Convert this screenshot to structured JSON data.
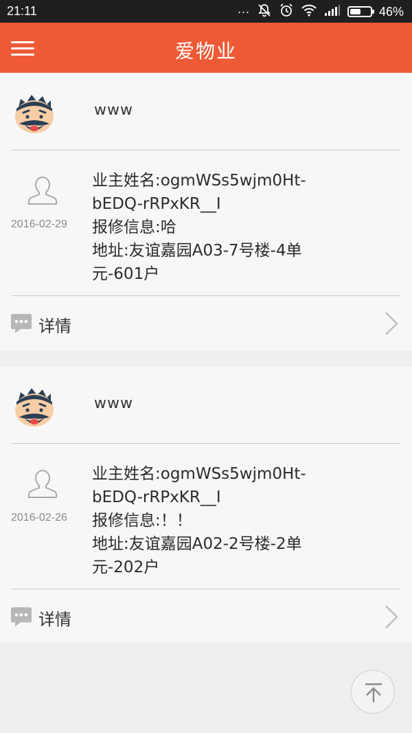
{
  "status_bar": {
    "time": "21:11",
    "signal_dots": "...",
    "battery_percent": "46%"
  },
  "header": {
    "title": "爱物业",
    "menu_icon": "hamburger-menu-icon"
  },
  "colors": {
    "header_bg": "#ee5a36",
    "status_bar_bg": "#1f1f1f",
    "card_bg": "#f7f7f7",
    "page_bg": "#efefef"
  },
  "posts": [
    {
      "poster_name": "www",
      "date": "2016-02-29",
      "info_lines": [
        "业主姓名:ogmWSs5wjm0Ht-",
        "bEDQ-rRPxKR__I",
        "报修信息:哈",
        "地址:友谊嘉园A03-7号楼-4单",
        "元-601户"
      ],
      "details_label": "详情"
    },
    {
      "poster_name": "www",
      "date": "2016-02-26",
      "info_lines": [
        "业主姓名:ogmWSs5wjm0Ht-",
        "bEDQ-rRPxKR__I",
        "报修信息:！！",
        "地址:友谊嘉园A02-2号楼-2单",
        "元-202户"
      ],
      "details_label": "详情"
    }
  ],
  "scroll_top_icon": "arrow-up-to-top-icon"
}
